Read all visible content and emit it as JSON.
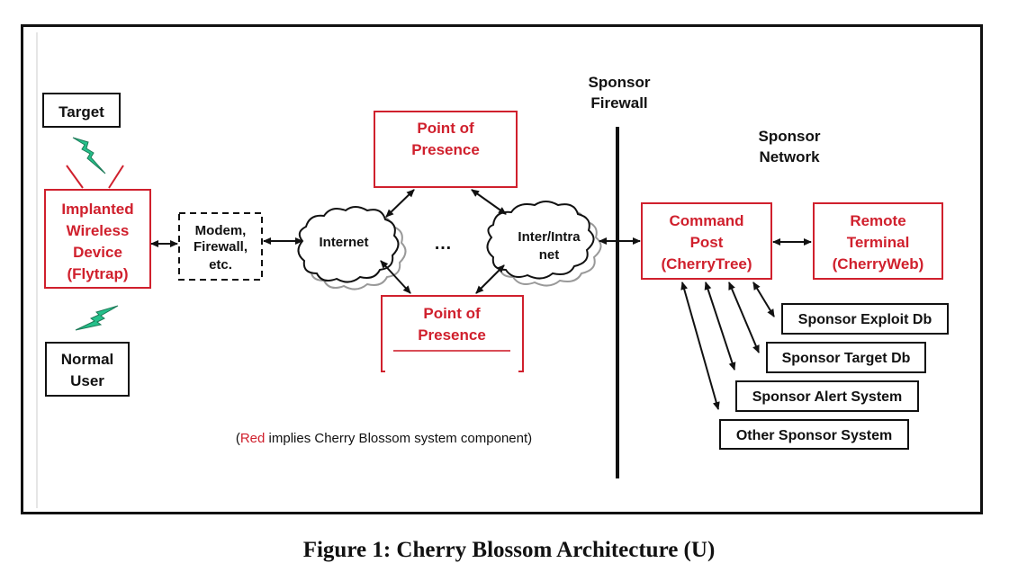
{
  "figure": {
    "caption": "Figure 1: Cherry Blossom Architecture (U)",
    "legend_note": {
      "open": "(",
      "red_word": "Red",
      "rest": " implies Cherry Blossom system component)"
    },
    "colors": {
      "system_component": "#d0202d",
      "external": "#111111",
      "wireless": "#25c08a",
      "cloud_shadow": "#999999"
    }
  },
  "nodes": {
    "target": {
      "lines": [
        "Target"
      ]
    },
    "normal_user": {
      "lines": [
        "Normal",
        "User"
      ]
    },
    "implanted_device": {
      "lines": [
        "Implanted",
        "Wireless",
        "Device",
        "(Flytrap)"
      ]
    },
    "modem": {
      "lines": [
        "Modem,",
        "Firewall,",
        "etc."
      ]
    },
    "internet": {
      "lines": [
        "Internet"
      ]
    },
    "ellipsis": "…",
    "intranet": {
      "lines": [
        "Inter/Intra",
        "net"
      ]
    },
    "pop_top": {
      "lines": [
        "Point of",
        "Presence"
      ]
    },
    "pop_bottom": {
      "lines": [
        "Point of",
        "Presence"
      ]
    },
    "sponsor_firewall": {
      "lines": [
        "Sponsor",
        "Firewall"
      ]
    },
    "sponsor_network": {
      "lines": [
        "Sponsor",
        "Network"
      ]
    },
    "command_post": {
      "lines": [
        "Command",
        "Post",
        "(CherryTree)"
      ]
    },
    "remote_terminal": {
      "lines": [
        "Remote",
        "Terminal",
        "(CherryWeb)"
      ]
    },
    "sponsor_exploit_db": {
      "lines": [
        "Sponsor Exploit Db"
      ]
    },
    "sponsor_target_db": {
      "lines": [
        "Sponsor Target Db"
      ]
    },
    "sponsor_alert_system": {
      "lines": [
        "Sponsor Alert System"
      ]
    },
    "other_sponsor_system": {
      "lines": [
        "Other Sponsor System"
      ]
    }
  }
}
